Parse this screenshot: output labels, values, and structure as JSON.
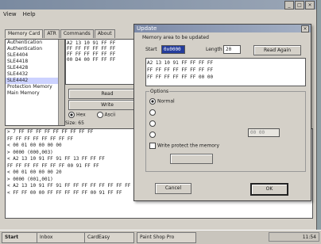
{
  "main": {
    "menu": [
      "View",
      "Help"
    ],
    "tabs": [
      "Memory Card",
      "ATR",
      "Commands",
      "About"
    ],
    "card_list": [
      "Authentication",
      "Authentication",
      "SLE4404",
      "SLE4418",
      "SLE4428",
      "SLE4432",
      "SLE4442",
      "Protection Memory",
      "Main Memory"
    ],
    "selected_card_index": 6,
    "memory_rows": [
      "A2 13 10 91 FF FF",
      "FF FF FF FF FF FF",
      "FF FF FF FF FF FF",
      "00 D4 00 FF FF FF"
    ],
    "read_button": "Read",
    "write_button": "Write",
    "radio_hex": "Hex",
    "radio_ascii": "Ascii",
    "size_label": "Size: 65",
    "log_rows": [
      "> 7 FF FF FF FF FF FF FF FF FF",
      "FF FF FF FF FF FF FF FF",
      "< 00 01 00 00 00 00",
      "> 0000 (000,003)",
      "< A2 13 10 91 FF 91 FF 13 FF FF FF",
      "FF FF FF FF FF FF FF 00 91 FF FF",
      "< 00 01 00 00 00 20",
      "> 0000 (001,001)",
      "< A2 13 10 91 FF 91 FF FF FF FF FF FF FF FF FF FF FF FF FF FF FF 00",
      "< FF FF 00 00 FF FF FF FF FF 00 91 FF FF"
    ]
  },
  "taskbar": {
    "start": "Start",
    "tasks": [
      "Inbox",
      "CardEasy",
      "Paint Shop Pro"
    ],
    "clock": "11:54"
  },
  "dialog": {
    "title": "Update",
    "subtitle": "Memory area to be updated",
    "start_label": "Start",
    "start_value": "0x0000",
    "length_label": "Length",
    "length_value": "20",
    "read_again": "Read Again",
    "hex_rows": [
      "A2 13 10 91 FF FF FF FF",
      "FF FF FF FF FF FF FF FF",
      "FF FF FF FF FF FF 00 00"
    ],
    "options_label": "Options",
    "radio_normal": "Normal",
    "write_protect": "Write protect the memory",
    "field_right": "00 00",
    "cancel": "Cancel",
    "ok": "OK"
  }
}
